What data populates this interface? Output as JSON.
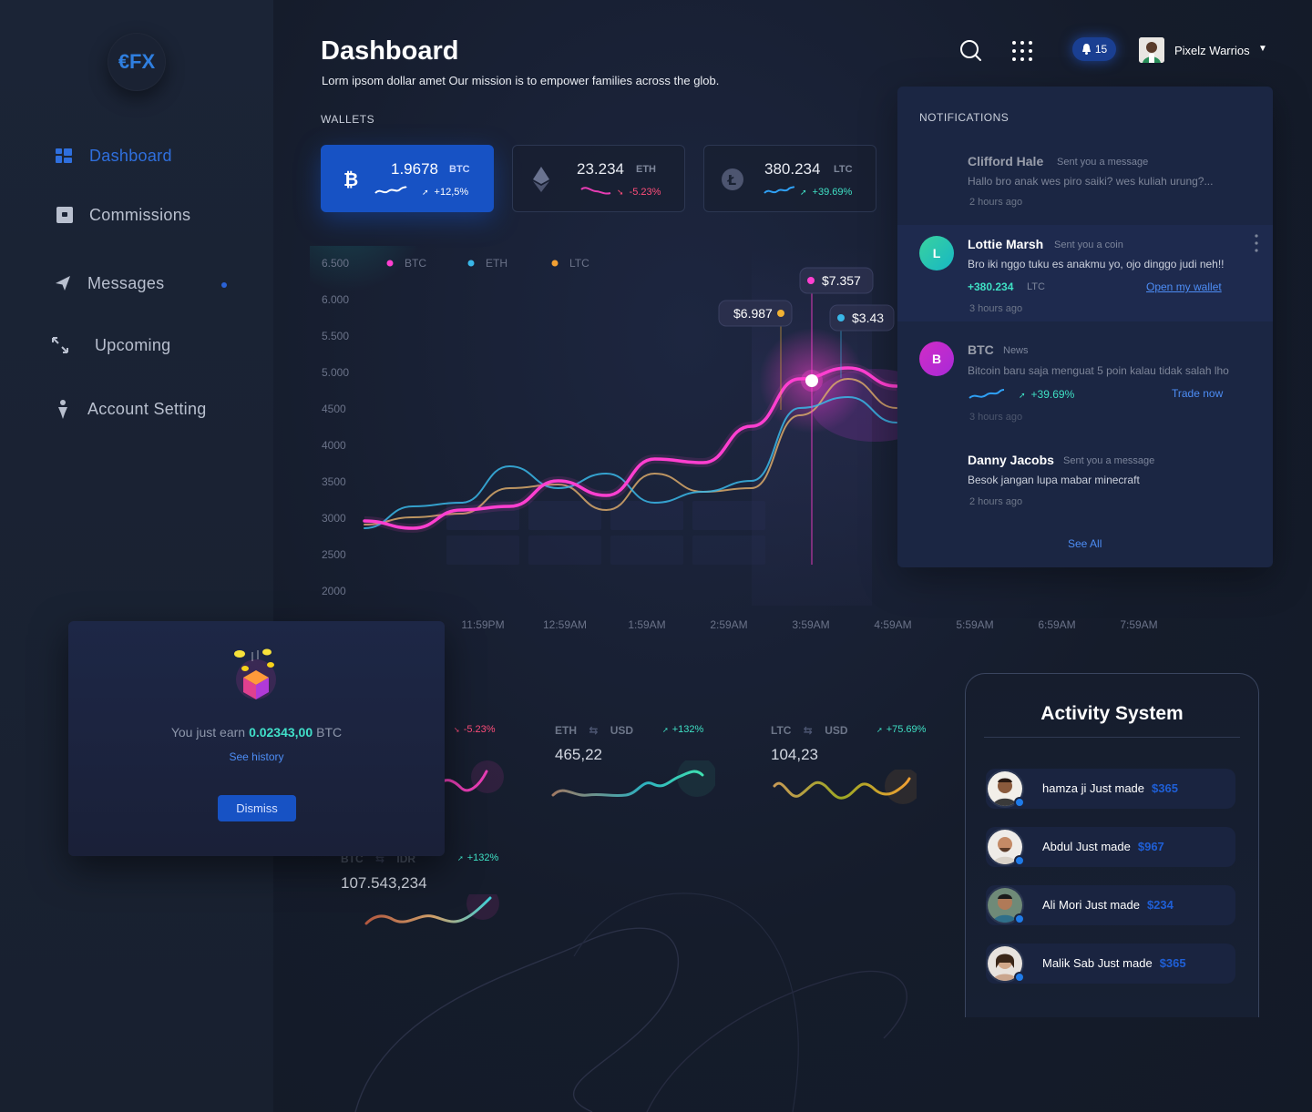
{
  "brand": {
    "logo_text": "€FX",
    "logo_color": "#2f7fe0"
  },
  "sidebar": {
    "items": [
      {
        "label": "Dashboard",
        "icon": "dashboard-icon",
        "active": true
      },
      {
        "label": "Commissions",
        "icon": "wallet-icon",
        "active": false
      },
      {
        "label": "Messages",
        "icon": "send-icon",
        "active": false,
        "unread": true
      },
      {
        "label": "Upcoming",
        "icon": "arrows-icon",
        "active": false
      },
      {
        "label": "Account Setting",
        "icon": "person-icon",
        "active": false
      }
    ]
  },
  "header": {
    "title": "Dashboard",
    "subtitle": "Lorm ipsom dollar amet Our mission is to empower families across the glob.",
    "notifications_count": "15",
    "user_name": "Pixelz Warrios"
  },
  "wallets": {
    "label": "WALLETS",
    "items": [
      {
        "value": "1.9678",
        "symbol": "BTC",
        "change": "+12,5%",
        "direction": "up",
        "icon": "bitcoin-icon"
      },
      {
        "value": "23.234",
        "symbol": "ETH",
        "change": "-5.23%",
        "direction": "down",
        "icon": "ethereum-icon"
      },
      {
        "value": "380.234",
        "symbol": "LTC",
        "change": "+39.69%",
        "direction": "up",
        "icon": "litecoin-icon"
      }
    ]
  },
  "chart_data": {
    "type": "line",
    "ylabels": [
      "6.500",
      "6.000",
      "5.500",
      "5.000",
      "4500",
      "4000",
      "3500",
      "3000",
      "2500",
      "2000"
    ],
    "ylim": [
      2000,
      6500
    ],
    "xlabels": [
      "11:59PM",
      "12:59AM",
      "1:59AM",
      "2:59AM",
      "3:59AM",
      "4:59AM",
      "5:59AM",
      "6:59AM",
      "7:59AM"
    ],
    "legend": [
      "BTC",
      "ETH",
      "LTC"
    ],
    "series": [
      {
        "name": "BTC",
        "color": "#ff3fd0",
        "values": [
          2950,
          2850,
          3100,
          3150,
          3500,
          3300,
          3800,
          3750,
          4250,
          4900,
          5050,
          4800
        ]
      },
      {
        "name": "ETH",
        "color": "#39b7e8",
        "values": [
          2850,
          3150,
          3200,
          3700,
          3400,
          3600,
          3200,
          3350,
          3500,
          4500,
          4650,
          4300
        ]
      },
      {
        "name": "LTC",
        "color": "#d9a96a",
        "values": [
          2900,
          3000,
          3050,
          3400,
          3450,
          3100,
          3600,
          3350,
          3400,
          4400,
          4900,
          4500
        ]
      }
    ],
    "tooltips": [
      {
        "label": "$7.357",
        "color": "#ff3fd0"
      },
      {
        "label": "$6.987",
        "color": "#f2b233"
      },
      {
        "label": "$3.43",
        "color": "#39b7e8"
      }
    ]
  },
  "notifications": {
    "title": "NOTIFICATIONS",
    "items": [
      {
        "name": "Clifford Hale",
        "tag": "Sent you a message",
        "message": "Hallo bro anak wes piro saiki? wes kuliah urung?...",
        "time": "2 hours ago"
      },
      {
        "initial": "L",
        "name": "Lottie Marsh",
        "tag": "Sent you a coin",
        "message": "Bro iki nggo tuku es anakmu yo, ojo dinggo judi neh!!",
        "amount": "+380.234",
        "coin": "LTC",
        "link": "Open my wallet",
        "time": "3 hours ago"
      },
      {
        "initial": "B",
        "name": "BTC",
        "tag": "News",
        "message": "Bitcoin baru saja menguat 5 poin kalau tidak salah lho",
        "change": "+39.69%",
        "link": "Trade now",
        "time": "3 hours ago"
      },
      {
        "name": "Danny Jacobs",
        "tag": "Sent you a message",
        "message": "Besok jangan lupa mabar minecraft",
        "time": "2 hours ago"
      }
    ],
    "see_all": "See All"
  },
  "earn_popup": {
    "prefix": "You just earn",
    "amount": "0.02343,00",
    "unit": "BTC",
    "history_link": "See history",
    "dismiss": "Dismiss"
  },
  "pairs": [
    {
      "from": "ETH",
      "to": "USD",
      "change": "+132%",
      "value": "465,22"
    },
    {
      "from": "LTC",
      "to": "USD",
      "change": "+75.69%",
      "value": "104,23"
    },
    {
      "change": "-5.23%"
    },
    {
      "from": "BTC",
      "to": "IDR",
      "change": "+132%",
      "value": "107.543,234"
    }
  ],
  "activity": {
    "title": "Activity System",
    "items": [
      {
        "name": "hamza ji",
        "action": "Just made",
        "amount": "$365"
      },
      {
        "name": "Abdul",
        "action": "Just made",
        "amount": "$967"
      },
      {
        "name": "Ali Mori",
        "action": "Just made",
        "amount": "$234"
      },
      {
        "name": "Malik Sab",
        "action": "Just made",
        "amount": "$365"
      }
    ]
  }
}
